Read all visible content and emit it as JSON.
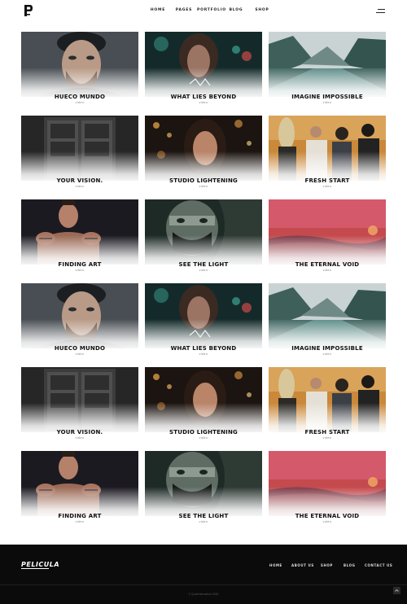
{
  "header": {
    "logo_text": "P",
    "nav": [
      "HOME",
      "PAGES",
      "PORTFOLIO",
      "BLOG",
      "SHOP"
    ]
  },
  "portfolio": {
    "items": [
      {
        "title": "HUECO MUNDO",
        "category": "video",
        "image": "bearded-man-beanie-portrait"
      },
      {
        "title": "WHAT LIES BEYOND",
        "category": "video",
        "image": "woman-neon-lights"
      },
      {
        "title": "IMAGINE IMPOSSIBLE",
        "category": "video",
        "image": "mountain-lake"
      },
      {
        "title": "YOUR VISION.",
        "category": "video",
        "image": "ornate-carved-door"
      },
      {
        "title": "STUDIO LIGHTENING",
        "category": "video",
        "image": "woman-bokeh-lights"
      },
      {
        "title": "FRESH START",
        "category": "video",
        "image": "band-group-photo"
      },
      {
        "title": "FINDING ART",
        "category": "video",
        "image": "tattooed-man-fists"
      },
      {
        "title": "SEE THE LIGHT",
        "category": "video",
        "image": "masked-face-car"
      },
      {
        "title": "THE ETERNAL VOID",
        "category": "video",
        "image": "red-sunset-fog"
      },
      {
        "title": "HUECO MUNDO",
        "category": "video",
        "image": "bearded-man-beanie-portrait"
      },
      {
        "title": "WHAT LIES BEYOND",
        "category": "video",
        "image": "woman-neon-lights"
      },
      {
        "title": "IMAGINE IMPOSSIBLE",
        "category": "video",
        "image": "mountain-lake"
      },
      {
        "title": "YOUR VISION.",
        "category": "video",
        "image": "ornate-carved-door"
      },
      {
        "title": "STUDIO LIGHTENING",
        "category": "video",
        "image": "woman-bokeh-lights"
      },
      {
        "title": "FRESH START",
        "category": "video",
        "image": "band-group-photo"
      },
      {
        "title": "FINDING ART",
        "category": "video",
        "image": "tattooed-man-fists"
      },
      {
        "title": "SEE THE LIGHT",
        "category": "video",
        "image": "masked-face-car"
      },
      {
        "title": "THE ETERNAL VOID",
        "category": "video",
        "image": "red-sunset-fog"
      }
    ]
  },
  "footer": {
    "logo_text": "PELICULA",
    "nav": [
      "HOME",
      "ABOUT US",
      "SHOP",
      "BLOG",
      "CONTACT US"
    ],
    "copyright": "© QodeInteractive 2020",
    "to_top_icon": "arrow-up-icon"
  },
  "colors": {
    "footer_bg": "#0b0b0b",
    "text": "#111111"
  }
}
